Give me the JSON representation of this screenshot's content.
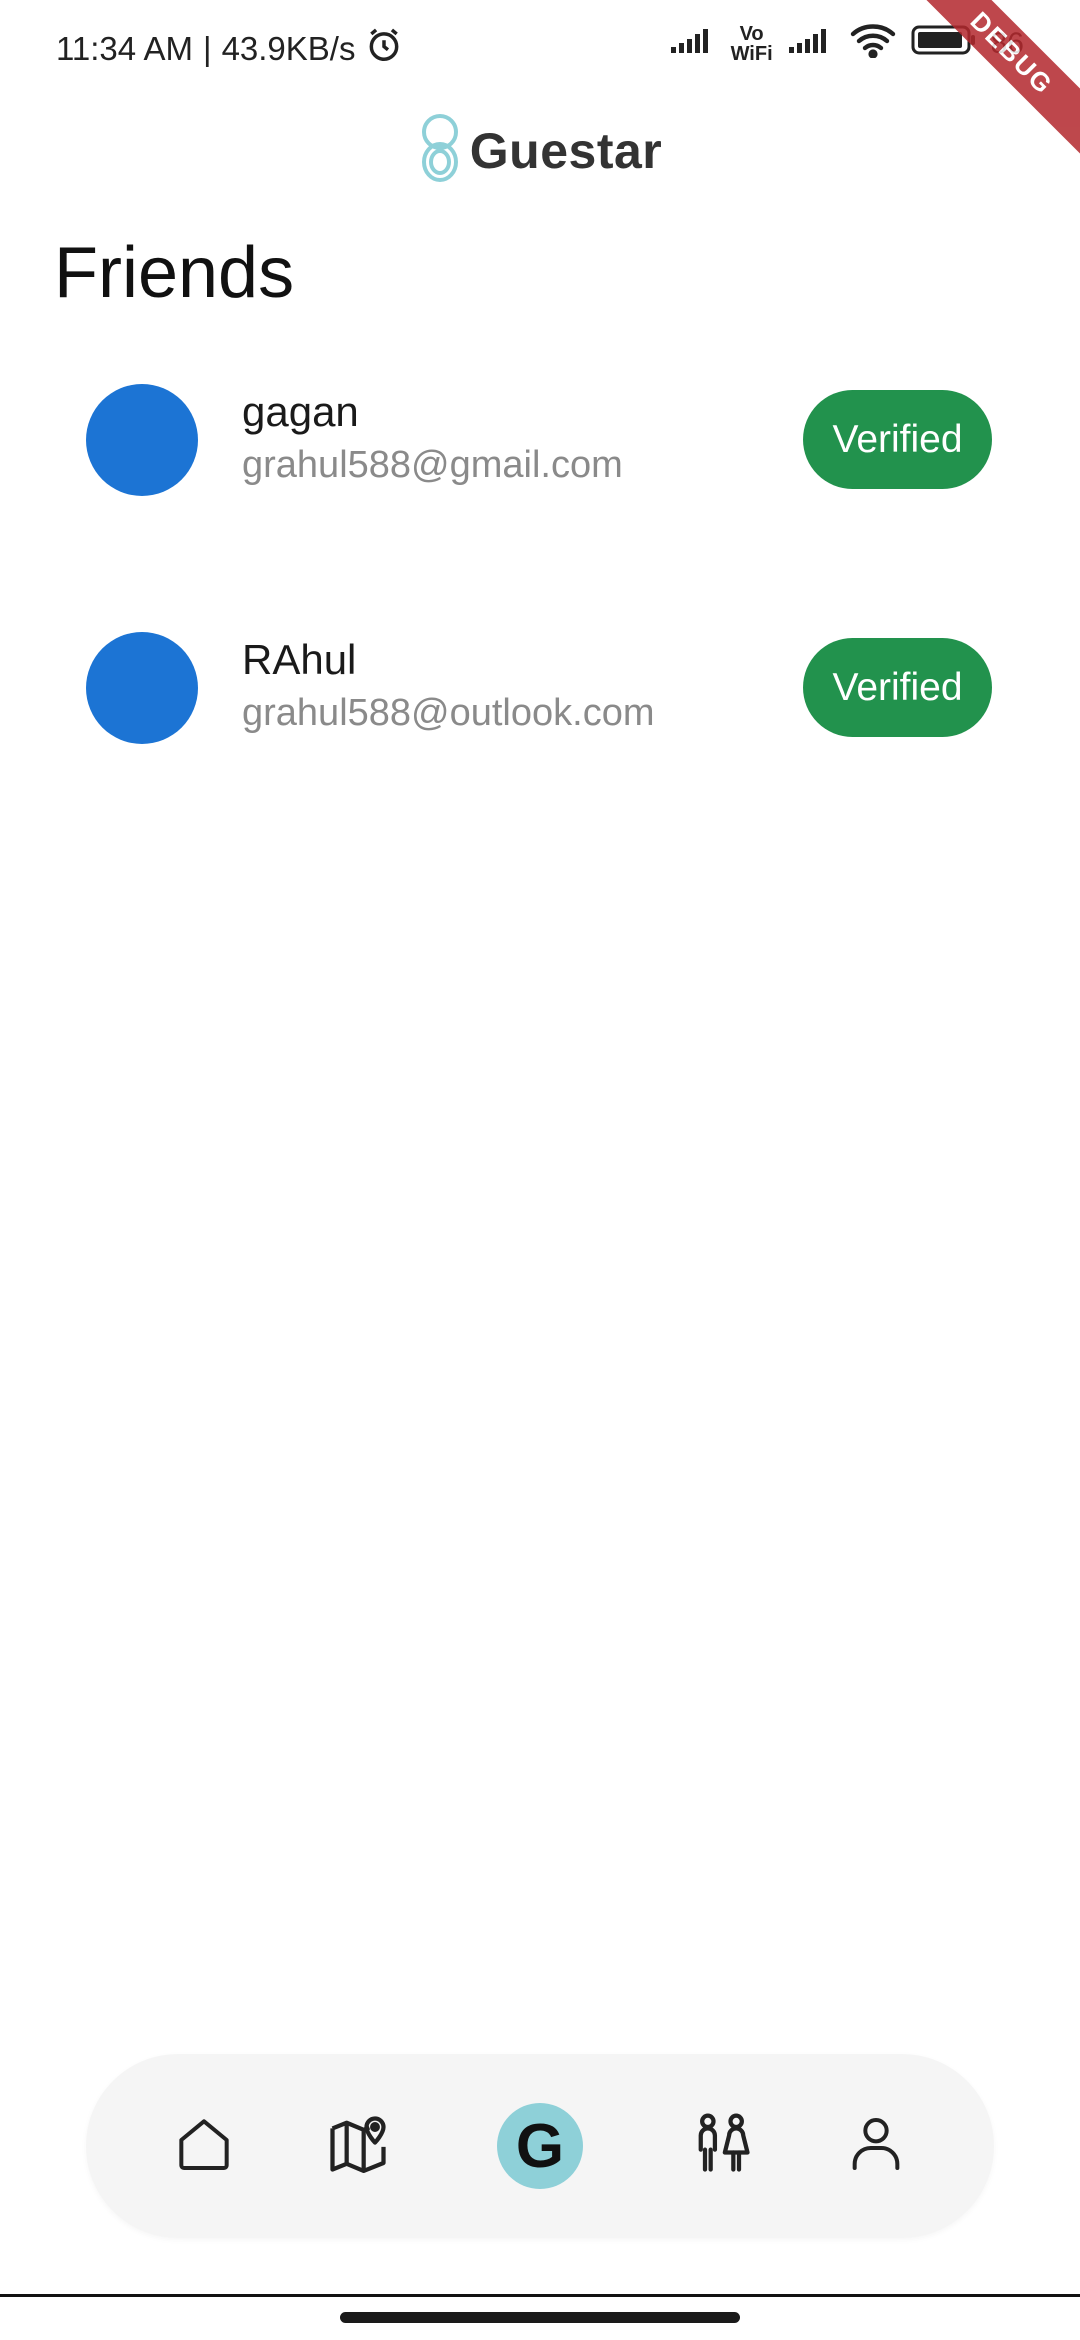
{
  "status_bar": {
    "time": "11:34 AM",
    "separator": "|",
    "speed": "43.9KB/s",
    "vowifi_top": "Vo",
    "vowifi_bottom": "WiFi",
    "battery": "86"
  },
  "debug_ribbon": "DEBUG",
  "header": {
    "brand": "Guestar"
  },
  "page": {
    "title": "Friends"
  },
  "friends": [
    {
      "name": "gagan",
      "email": "grahul588@gmail.com",
      "status": "Verified"
    },
    {
      "name": "RAhul",
      "email": "grahul588@outlook.com",
      "status": "Verified"
    }
  ],
  "nav": {
    "center_letter": "G",
    "items": [
      "home-icon",
      "map-pin-icon",
      "guestar-g-icon",
      "people-icon",
      "profile-icon"
    ]
  },
  "colors": {
    "avatar": "#1c74d4",
    "verified": "#22924d",
    "accent": "#8ed0d8",
    "ribbon": "#b3282d"
  }
}
